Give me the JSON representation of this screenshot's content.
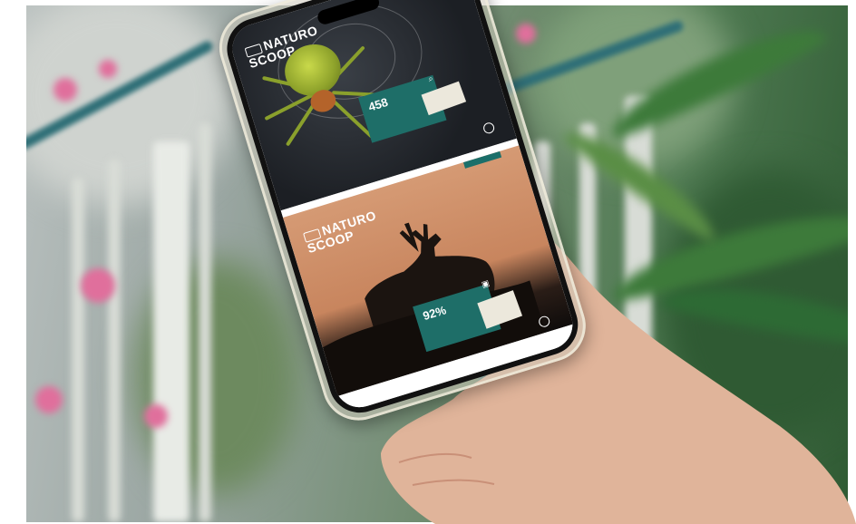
{
  "scene": {
    "description_colors": {
      "background_green": "#4f7a52",
      "railing_teal": "#2f6f77",
      "flower_pink": "#e06f9c",
      "skin": "#e2b9a0"
    }
  },
  "phone": {
    "card_top": {
      "logo_line1": "NATURO",
      "logo_line2": "SCOOP",
      "stat_number": "458",
      "stat_text": "",
      "paper_note": "",
      "accent": "#1e6e68"
    },
    "card_bottom": {
      "logo_line1": "NATURO",
      "logo_line2": "SCOOP",
      "stat_number": "92%",
      "stat_text": "",
      "paper_note": "",
      "accent": "#1e6e68"
    }
  }
}
